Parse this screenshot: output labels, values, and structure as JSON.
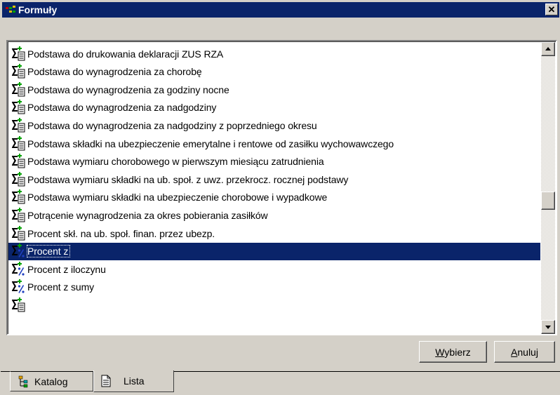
{
  "window": {
    "title": "Formuły"
  },
  "title_icon": "formula-window-icon",
  "close_icon": "close-icon",
  "list": {
    "items": [
      {
        "label": "Podstawa do drukowania deklaracji ZUS RZA",
        "icon": "sum-formula-icon",
        "selected": false
      },
      {
        "label": "Podstawa do wynagrodzenia za chorobę",
        "icon": "sum-formula-icon",
        "selected": false
      },
      {
        "label": "Podstawa do wynagrodzenia za godziny nocne",
        "icon": "sum-formula-icon",
        "selected": false
      },
      {
        "label": "Podstawa do wynagrodzenia za nadgodziny",
        "icon": "sum-formula-icon",
        "selected": false
      },
      {
        "label": "Podstawa do wynagrodzenia za nadgodziny z poprzedniego okresu",
        "icon": "sum-formula-icon",
        "selected": false
      },
      {
        "label": "Podstawa składki na ubezpieczenie emerytalne i rentowe od zasiłku wychowawczego",
        "icon": "sum-formula-icon",
        "selected": false
      },
      {
        "label": "Podstawa wymiaru chorobowego w pierwszym miesiącu zatrudnienia",
        "icon": "sum-formula-icon",
        "selected": false
      },
      {
        "label": "Podstawa wymiaru składki na ub. społ. z uwz. przekrocz. rocznej podstawy",
        "icon": "sum-formula-icon",
        "selected": false
      },
      {
        "label": "Podstawa wymiaru składki na ubezpieczenie chorobowe i wypadkowe",
        "icon": "sum-formula-icon",
        "selected": false
      },
      {
        "label": "Potrącenie wynagrodzenia za okres pobierania zasiłków",
        "icon": "sum-formula-icon",
        "selected": false
      },
      {
        "label": "Procent skł. na ub. społ. finan. przez ubezp.",
        "icon": "sum-formula-icon",
        "selected": false
      },
      {
        "label": "Procent z",
        "icon": "percent-formula-icon",
        "selected": true
      },
      {
        "label": "Procent z iloczynu",
        "icon": "percent-formula-icon",
        "selected": false
      },
      {
        "label": "Procent z sumy",
        "icon": "percent-formula-icon",
        "selected": false
      }
    ]
  },
  "scrollbar": {
    "position_fraction": 0.55
  },
  "buttons": {
    "wybierz": {
      "hotkey": "W",
      "rest": "ybierz"
    },
    "anuluj": {
      "hotkey": "A",
      "rest": "nuluj"
    }
  },
  "tabs": [
    {
      "label": "Katalog",
      "icon": "tree-catalog-icon",
      "active": false
    },
    {
      "label": "Lista",
      "icon": "document-list-icon",
      "active": true
    }
  ],
  "colors": {
    "titlebar": "#0a246a",
    "selection": "#0a246a",
    "face": "#d4d0c8"
  }
}
